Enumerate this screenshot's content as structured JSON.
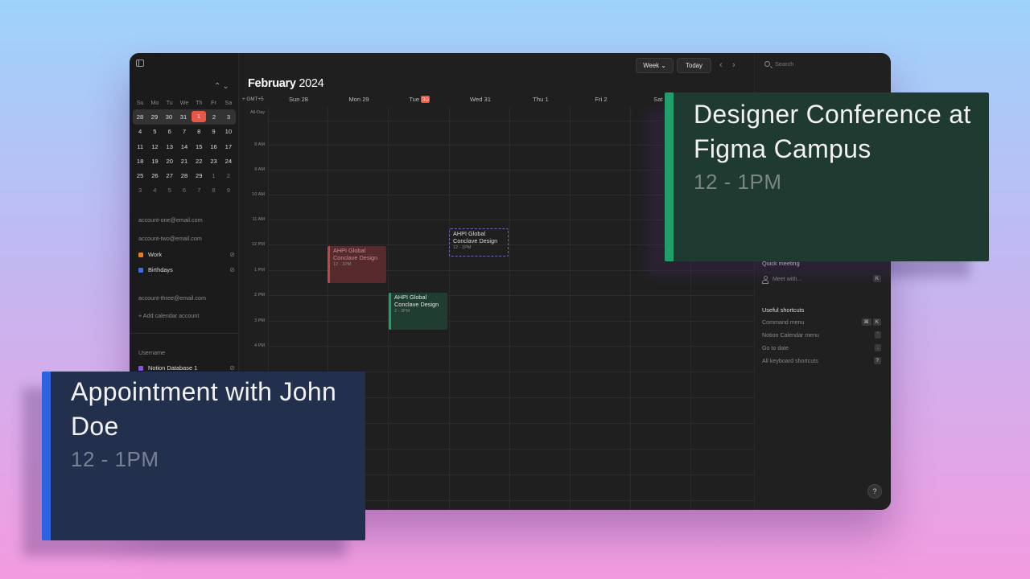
{
  "mini_calendar": {
    "weekdays": [
      "Su",
      "Mo",
      "Tu",
      "We",
      "Th",
      "Fr",
      "Sa"
    ],
    "weeks": [
      [
        "28",
        "29",
        "30",
        "31",
        "1",
        "2",
        "3"
      ],
      [
        "4",
        "5",
        "6",
        "7",
        "8",
        "9",
        "10"
      ],
      [
        "11",
        "12",
        "13",
        "14",
        "15",
        "16",
        "17"
      ],
      [
        "18",
        "19",
        "20",
        "21",
        "22",
        "23",
        "24"
      ],
      [
        "25",
        "26",
        "27",
        "28",
        "29",
        "1",
        "2"
      ],
      [
        "3",
        "4",
        "5",
        "6",
        "7",
        "8",
        "9"
      ]
    ],
    "today": "1"
  },
  "sidebar": {
    "account_one": "account-one@email.com",
    "account_two": "account-two@email.com",
    "calendars": [
      {
        "label": "Work",
        "color": "#e5801d"
      },
      {
        "label": "Birthdays",
        "color": "#3b6ff0"
      }
    ],
    "account_three": "account-three@email.com",
    "add_account": "+ Add calendar account",
    "username_heading": "Username",
    "notion_db": {
      "label": "Notion Database 1",
      "color": "#8b4fe8"
    }
  },
  "header": {
    "month": "February",
    "year": "2024",
    "view_label": "Week",
    "view_chevron": "⌄",
    "today_label": "Today",
    "prev_glyph": "‹",
    "next_glyph": "›"
  },
  "week": {
    "timezone": "+ GMT+5",
    "days": [
      {
        "label": "Sun 28"
      },
      {
        "label": "Mon 29"
      },
      {
        "pre": "Tue ",
        "badge": "30"
      },
      {
        "label": "Wed 31"
      },
      {
        "label": "Thu 1"
      },
      {
        "label": "Fri 2"
      },
      {
        "label": "Sat 3"
      }
    ],
    "all_day": "All-Day",
    "times": [
      "8 AM",
      "9 AM",
      "10 AM",
      "11 AM",
      "12 PM",
      "1 PM",
      "2 PM",
      "3 PM",
      "4 PM"
    ]
  },
  "events": [
    {
      "title": "AHPI Global Conclave Design",
      "time": "12 - 1PM"
    },
    {
      "title": "AHPI Global Conclave Design",
      "time": "2 - 3PM"
    },
    {
      "title": "AHPI Global Conclave Design",
      "time": "12 - 1PM"
    }
  ],
  "right_panel": {
    "search_placeholder": "Search",
    "quick_meeting_heading": "Quick meeting",
    "meet_with": "Meet with...",
    "meet_key": "K",
    "shortcuts_heading": "Useful shortcuts",
    "shortcuts": [
      {
        "label": "Command menu",
        "keys": [
          "⌘",
          "K"
        ]
      },
      {
        "label": "Notion Calendar menu",
        "keys": [
          "`"
        ]
      },
      {
        "label": "Go to date",
        "keys": [
          "."
        ]
      },
      {
        "label": "All keyboard shortcuts",
        "keys": [
          "?"
        ]
      }
    ],
    "help": "?"
  },
  "cards": {
    "conference": {
      "title": "Designer Conference at Figma Campus",
      "time": "12 - 1PM",
      "accent": "#1fa06a"
    },
    "appointment": {
      "title": "Appointment with John Doe",
      "time": "12 - 1PM",
      "accent": "#2d63e0"
    }
  }
}
